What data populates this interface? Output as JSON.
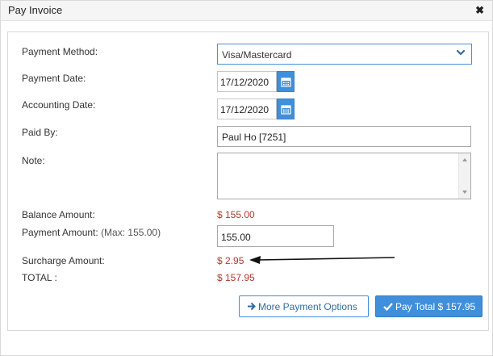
{
  "dialog": {
    "title": "Pay Invoice",
    "close_glyph": "✖"
  },
  "form": {
    "payment_method_label": "Payment Method:",
    "payment_method_value": "Visa/Mastercard",
    "payment_date_label": "Payment Date:",
    "payment_date_value": "17/12/2020",
    "accounting_date_label": "Accounting Date:",
    "accounting_date_value": "17/12/2020",
    "paid_by_label": "Paid By:",
    "paid_by_value": "Paul Ho [7251]",
    "note_label": "Note:",
    "note_value": "",
    "balance_label": "Balance Amount:",
    "balance_value": "$ 155.00",
    "payment_amount_label": "Payment Amount:",
    "payment_amount_max": "(Max: 155.00)",
    "payment_amount_value": "155.00",
    "surcharge_label": "Surcharge Amount:",
    "surcharge_value": "$ 2.95",
    "total_label": "TOTAL :",
    "total_value": "$ 157.95"
  },
  "buttons": {
    "more_options": "More Payment Options",
    "pay_total": "Pay Total $ 157.95"
  },
  "icons": {
    "calendar": "calendar-icon",
    "chevron": "chevron-down-icon",
    "arrow_right": "arrow-right-icon",
    "check": "check-icon"
  },
  "colors": {
    "accent": "#3f8fdc",
    "amount": "#b03a2e"
  }
}
